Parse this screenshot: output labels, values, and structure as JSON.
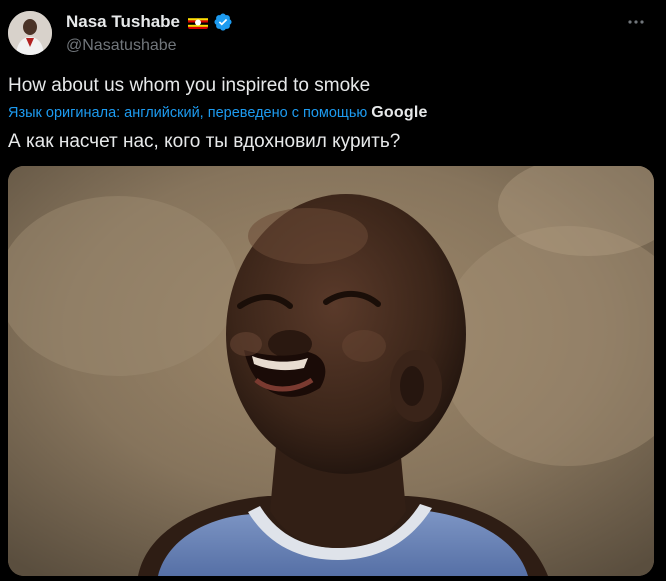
{
  "author": {
    "name": "Nasa Tushabe",
    "handle": "@Nasatushabe",
    "flag_icon": "uganda-flag-icon",
    "verified_icon": "verified-badge-icon",
    "verified_color": "#1d9bf0"
  },
  "tweet": {
    "text": "How about us whom you inspired to smoke",
    "translation_note": "Язык оригинала: английский, переведено с помощью",
    "translation_provider": "Google",
    "translated_text": "А как насчет нас, кого ты вдохновил курить?"
  },
  "menu": {
    "more_icon": "more-horizontal-icon"
  },
  "colors": {
    "background": "#000000",
    "text": "#e7e9ea",
    "secondary_text": "#71767b",
    "link": "#1d9bf0"
  }
}
